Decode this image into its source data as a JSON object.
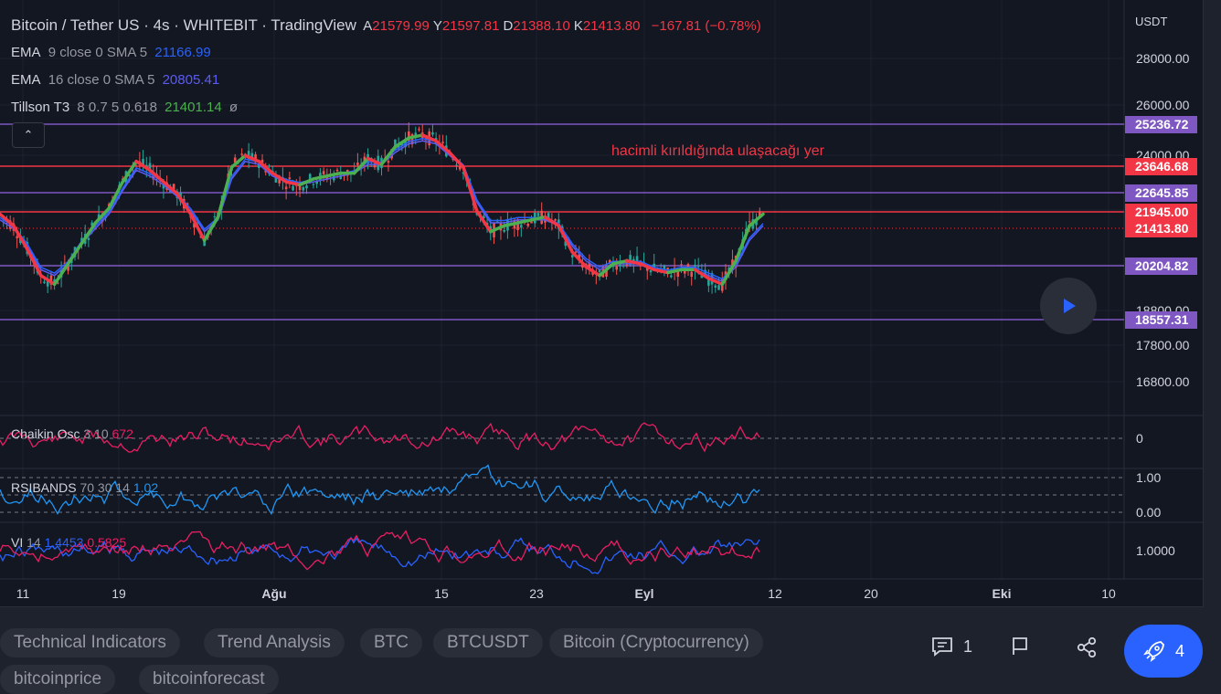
{
  "header": {
    "title": "Bitcoin / Tether US · 4s · WHITEBIT · TradingView",
    "ohlc": [
      {
        "key": "A",
        "value": "21579.99"
      },
      {
        "key": "Y",
        "value": "21597.81"
      },
      {
        "key": "D",
        "value": "21388.10"
      },
      {
        "key": "K",
        "value": "21413.80"
      }
    ],
    "change": "−167.81 (−0.78%)"
  },
  "indicators": [
    {
      "name": "EMA",
      "params": "9 close 0 SMA 5",
      "value": "21166.99",
      "color": "#2962ff"
    },
    {
      "name": "EMA",
      "params": "16 close 0 SMA 5",
      "value": "20805.41",
      "color": "#3f3fd6"
    },
    {
      "name": "Tillson T3",
      "params": "8 0.7 5 0.618",
      "value": "21401.14",
      "color": "#4caf50",
      "extra": "ø"
    }
  ],
  "panes": {
    "chaikin": {
      "name": "Chaikin Osc",
      "params": "3 10",
      "value": "672",
      "zero_label": "0"
    },
    "rsibands": {
      "name": "RSIBANDS",
      "params": "70 30 14",
      "value": "1.02",
      "top_label": "1.00",
      "bottom_label": "0.00"
    },
    "vi": {
      "name": "VI",
      "params": "14",
      "value_plus": "1.4453",
      "value_minus": "0.5825",
      "mid_label": "1.0000"
    }
  },
  "annotation": "hacimli kırıldığında ulaşacağı yer",
  "currency": "USDT",
  "chart_data": {
    "type": "candlestick",
    "y_axis": {
      "ticks": [
        "28000.00",
        "26000.00",
        "24000.00",
        "18800.00",
        "17800.00",
        "16800.00"
      ],
      "range": [
        16000,
        29000
      ]
    },
    "x_axis": {
      "ticks": [
        "11",
        "19",
        "Ağu",
        "15",
        "23",
        "Eyl",
        "12",
        "20",
        "Eki",
        "10"
      ]
    },
    "levels": [
      {
        "value": 25236.72,
        "label": "25236.72",
        "color": "#7e57c2"
      },
      {
        "value": 23646.68,
        "label": "23646.68",
        "color": "#f23645"
      },
      {
        "value": 22645.85,
        "label": "22645.85",
        "color": "#7e57c2"
      },
      {
        "value": 21945.0,
        "label": "21945.00",
        "color": "#f23645"
      },
      {
        "value": 21413.8,
        "label": "21413.80",
        "color": "#f23645",
        "dotted": true
      },
      {
        "value": 20204.82,
        "label": "20204.82",
        "color": "#7e57c2"
      },
      {
        "value": 18557.31,
        "label": "18557.31",
        "color": "#7e57c2"
      }
    ],
    "series": [
      {
        "name": "Tillson T3",
        "color": "#4caf50",
        "color_down": "#f23645",
        "values": [
          21900,
          21500,
          20700,
          19800,
          19500,
          20200,
          20900,
          21600,
          22100,
          23000,
          23700,
          23400,
          23000,
          22600,
          21900,
          21000,
          21800,
          23500,
          23900,
          23700,
          23300,
          23000,
          22900,
          23100,
          23200,
          23300,
          23300,
          23800,
          23600,
          24200,
          24500,
          24600,
          24400,
          24000,
          23500,
          22000,
          21300,
          21500,
          21600,
          21700,
          21800,
          21500,
          20600,
          20100,
          19800,
          20200,
          20300,
          20200,
          20000,
          19900,
          20000,
          20000,
          19700,
          19500,
          20300,
          21500,
          21900
        ]
      },
      {
        "name": "EMA 9",
        "color": "#2962ff",
        "values": [
          21700,
          21400,
          20800,
          20000,
          19800,
          20200,
          20900,
          21400,
          21900,
          22700,
          23400,
          23200,
          22900,
          22500,
          22000,
          21300,
          21700,
          23100,
          23700,
          23600,
          23200,
          23000,
          22900,
          23000,
          23100,
          23200,
          23300,
          23600,
          23600,
          24000,
          24300,
          24400,
          24300,
          23900,
          23500,
          22300,
          21600,
          21600,
          21700,
          21700,
          21700,
          21500,
          20800,
          20300,
          20000,
          20200,
          20200,
          20200,
          20000,
          19900,
          20000,
          20000,
          19800,
          19600,
          20100,
          21000,
          21500
        ]
      }
    ],
    "candle_hint": "Candles sampled around the T3 line"
  },
  "footer": {
    "tags": [
      "Technical Indicators",
      "Trend Analysis",
      "BTC",
      "BTCUSDT",
      "Bitcoin (Cryptocurrency)",
      "bitcoinprice",
      "bitcoinforecast"
    ],
    "comments_count": "1",
    "boosts_count": "4"
  },
  "colors": {
    "bg": "#131722",
    "accent": "#2962ff",
    "down": "#f23645",
    "up": "#26a69a",
    "level_purple": "#7e57c2"
  }
}
